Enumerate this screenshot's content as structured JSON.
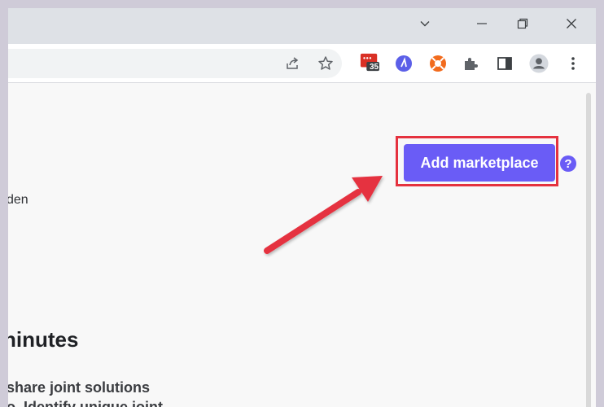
{
  "browser": {
    "extensions": [
      {
        "name": "calendar-extension-icon",
        "badge": "35"
      }
    ]
  },
  "page": {
    "add_marketplace_label": "Add marketplace",
    "help_label": "?",
    "fragment_den": "den",
    "fragment_heading": "ninutes",
    "fragment_line1": "share joint solutions",
    "fragment_line2": "o. Identify unique joint"
  },
  "colors": {
    "accent": "#6a5cf6",
    "highlight": "#e5323f",
    "arrow": "#e5323f"
  }
}
